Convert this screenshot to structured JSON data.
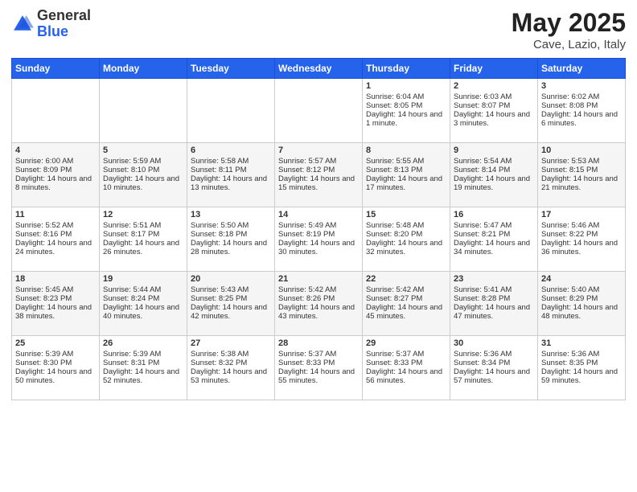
{
  "header": {
    "logo_general": "General",
    "logo_blue": "Blue",
    "title": "May 2025",
    "location": "Cave, Lazio, Italy"
  },
  "days_of_week": [
    "Sunday",
    "Monday",
    "Tuesday",
    "Wednesday",
    "Thursday",
    "Friday",
    "Saturday"
  ],
  "weeks": [
    [
      {
        "day": "",
        "content": ""
      },
      {
        "day": "",
        "content": ""
      },
      {
        "day": "",
        "content": ""
      },
      {
        "day": "",
        "content": ""
      },
      {
        "day": "1",
        "content": "Sunrise: 6:04 AM\nSunset: 8:05 PM\nDaylight: 14 hours and 1 minute."
      },
      {
        "day": "2",
        "content": "Sunrise: 6:03 AM\nSunset: 8:07 PM\nDaylight: 14 hours and 3 minutes."
      },
      {
        "day": "3",
        "content": "Sunrise: 6:02 AM\nSunset: 8:08 PM\nDaylight: 14 hours and 6 minutes."
      }
    ],
    [
      {
        "day": "4",
        "content": "Sunrise: 6:00 AM\nSunset: 8:09 PM\nDaylight: 14 hours and 8 minutes."
      },
      {
        "day": "5",
        "content": "Sunrise: 5:59 AM\nSunset: 8:10 PM\nDaylight: 14 hours and 10 minutes."
      },
      {
        "day": "6",
        "content": "Sunrise: 5:58 AM\nSunset: 8:11 PM\nDaylight: 14 hours and 13 minutes."
      },
      {
        "day": "7",
        "content": "Sunrise: 5:57 AM\nSunset: 8:12 PM\nDaylight: 14 hours and 15 minutes."
      },
      {
        "day": "8",
        "content": "Sunrise: 5:55 AM\nSunset: 8:13 PM\nDaylight: 14 hours and 17 minutes."
      },
      {
        "day": "9",
        "content": "Sunrise: 5:54 AM\nSunset: 8:14 PM\nDaylight: 14 hours and 19 minutes."
      },
      {
        "day": "10",
        "content": "Sunrise: 5:53 AM\nSunset: 8:15 PM\nDaylight: 14 hours and 21 minutes."
      }
    ],
    [
      {
        "day": "11",
        "content": "Sunrise: 5:52 AM\nSunset: 8:16 PM\nDaylight: 14 hours and 24 minutes."
      },
      {
        "day": "12",
        "content": "Sunrise: 5:51 AM\nSunset: 8:17 PM\nDaylight: 14 hours and 26 minutes."
      },
      {
        "day": "13",
        "content": "Sunrise: 5:50 AM\nSunset: 8:18 PM\nDaylight: 14 hours and 28 minutes."
      },
      {
        "day": "14",
        "content": "Sunrise: 5:49 AM\nSunset: 8:19 PM\nDaylight: 14 hours and 30 minutes."
      },
      {
        "day": "15",
        "content": "Sunrise: 5:48 AM\nSunset: 8:20 PM\nDaylight: 14 hours and 32 minutes."
      },
      {
        "day": "16",
        "content": "Sunrise: 5:47 AM\nSunset: 8:21 PM\nDaylight: 14 hours and 34 minutes."
      },
      {
        "day": "17",
        "content": "Sunrise: 5:46 AM\nSunset: 8:22 PM\nDaylight: 14 hours and 36 minutes."
      }
    ],
    [
      {
        "day": "18",
        "content": "Sunrise: 5:45 AM\nSunset: 8:23 PM\nDaylight: 14 hours and 38 minutes."
      },
      {
        "day": "19",
        "content": "Sunrise: 5:44 AM\nSunset: 8:24 PM\nDaylight: 14 hours and 40 minutes."
      },
      {
        "day": "20",
        "content": "Sunrise: 5:43 AM\nSunset: 8:25 PM\nDaylight: 14 hours and 42 minutes."
      },
      {
        "day": "21",
        "content": "Sunrise: 5:42 AM\nSunset: 8:26 PM\nDaylight: 14 hours and 43 minutes."
      },
      {
        "day": "22",
        "content": "Sunrise: 5:42 AM\nSunset: 8:27 PM\nDaylight: 14 hours and 45 minutes."
      },
      {
        "day": "23",
        "content": "Sunrise: 5:41 AM\nSunset: 8:28 PM\nDaylight: 14 hours and 47 minutes."
      },
      {
        "day": "24",
        "content": "Sunrise: 5:40 AM\nSunset: 8:29 PM\nDaylight: 14 hours and 48 minutes."
      }
    ],
    [
      {
        "day": "25",
        "content": "Sunrise: 5:39 AM\nSunset: 8:30 PM\nDaylight: 14 hours and 50 minutes."
      },
      {
        "day": "26",
        "content": "Sunrise: 5:39 AM\nSunset: 8:31 PM\nDaylight: 14 hours and 52 minutes."
      },
      {
        "day": "27",
        "content": "Sunrise: 5:38 AM\nSunset: 8:32 PM\nDaylight: 14 hours and 53 minutes."
      },
      {
        "day": "28",
        "content": "Sunrise: 5:37 AM\nSunset: 8:33 PM\nDaylight: 14 hours and 55 minutes."
      },
      {
        "day": "29",
        "content": "Sunrise: 5:37 AM\nSunset: 8:33 PM\nDaylight: 14 hours and 56 minutes."
      },
      {
        "day": "30",
        "content": "Sunrise: 5:36 AM\nSunset: 8:34 PM\nDaylight: 14 hours and 57 minutes."
      },
      {
        "day": "31",
        "content": "Sunrise: 5:36 AM\nSunset: 8:35 PM\nDaylight: 14 hours and 59 minutes."
      }
    ]
  ]
}
